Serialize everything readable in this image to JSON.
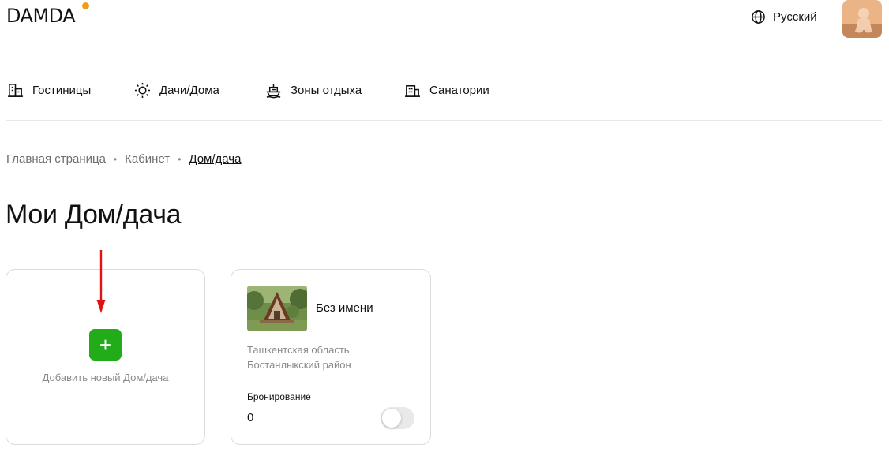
{
  "header": {
    "logo": "DAMDA",
    "language": "Русский",
    "colors": {
      "logo_dot": "#f29c1f"
    }
  },
  "categories": [
    {
      "label": "Гостиницы",
      "icon": "building-icon"
    },
    {
      "label": "Дачи/Дома",
      "icon": "sun-icon"
    },
    {
      "label": "Зоны отдыха",
      "icon": "boat-icon"
    },
    {
      "label": "Санатории",
      "icon": "sanatorium-icon"
    }
  ],
  "breadcrumb": [
    "Главная страница",
    "Кабинет",
    "Дом/дача"
  ],
  "page_title": "Мои Дом/дача",
  "add_card": {
    "button_symbol": "+",
    "label": "Добавить новый Дом/дача",
    "colors": {
      "button": "#22ac1a",
      "arrow": "#e01212"
    }
  },
  "listing": {
    "name": "Без имени",
    "address_line1": "Ташкентская область,",
    "address_line2": "Бостанлыкский район",
    "booking_label": "Бронирование",
    "booking_count": "0",
    "booking_toggle_on": false
  }
}
